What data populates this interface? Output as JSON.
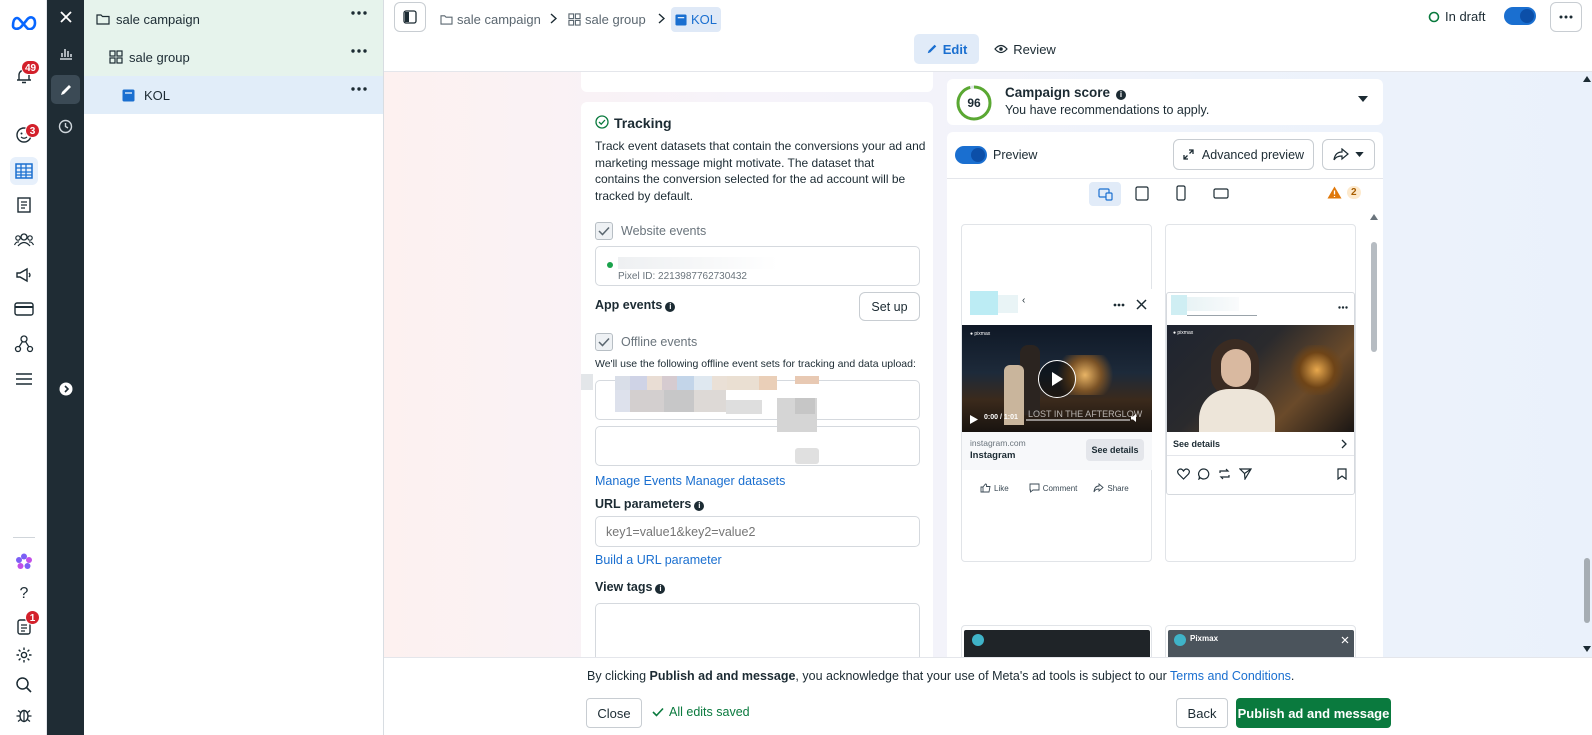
{
  "rail": {
    "notifications_badge": "49",
    "ads_badge": "3",
    "bottom_badge": "1"
  },
  "tree": {
    "items": [
      {
        "label": "sale campaign"
      },
      {
        "label": "sale group"
      },
      {
        "label": "KOL"
      }
    ]
  },
  "header": {
    "breadcrumb": [
      "sale campaign",
      "sale group",
      "KOL"
    ],
    "status": "In draft",
    "edit_label": "Edit",
    "review_label": "Review"
  },
  "tracking": {
    "title": "Tracking",
    "description": [
      "Track event datasets that contain the conversions your ad and",
      "marketing message might motivate. The dataset that",
      "contains the conversion selected for the ad account will be",
      "tracked by default."
    ],
    "website_events_label": "Website events",
    "pixel_id": "Pixel ID: 2213987762730432",
    "app_events_label": "App events",
    "setup_label": "Set up",
    "offline_events_label": "Offline events",
    "offline_note": "We'll use the following offline event sets for tracking and data upload:",
    "manage_link": "Manage Events Manager datasets",
    "url_params_label": "URL parameters",
    "url_params_placeholder": "key1=value1&key2=value2",
    "build_url_link": "Build a URL parameter",
    "view_tags_label": "View tags"
  },
  "score": {
    "value": "96",
    "title": "Campaign score",
    "subtitle": "You have recommendations to apply."
  },
  "preview": {
    "toggle_label": "Preview",
    "advanced_label": "Advanced preview",
    "warning_count": "2",
    "left": {
      "video_time": "0:00 / 1:01",
      "video_caption": "LOST IN THE AFTERGLOW",
      "domain": "instagram.com",
      "source": "Instagram",
      "cta": "See details",
      "like": "Like",
      "comment": "Comment",
      "share": "Share"
    },
    "right": {
      "cta": "See details"
    },
    "bottom_name": "Pixmax"
  },
  "footer": {
    "notice_prefix": "By clicking ",
    "notice_bold": "Publish ad and message",
    "notice_mid": ", you acknowledge that your use of Meta's ad tools is subject to our ",
    "terms_link": "Terms and Conditions",
    "notice_suffix": ".",
    "close_label": "Close",
    "saved_label": "All edits saved",
    "back_label": "Back",
    "publish_label": "Publish ad and message"
  },
  "colors": {
    "accent": "#1a6fd0",
    "publish": "#0a7a3e",
    "score_ring": "#5aa832",
    "badge": "#d3202b"
  }
}
